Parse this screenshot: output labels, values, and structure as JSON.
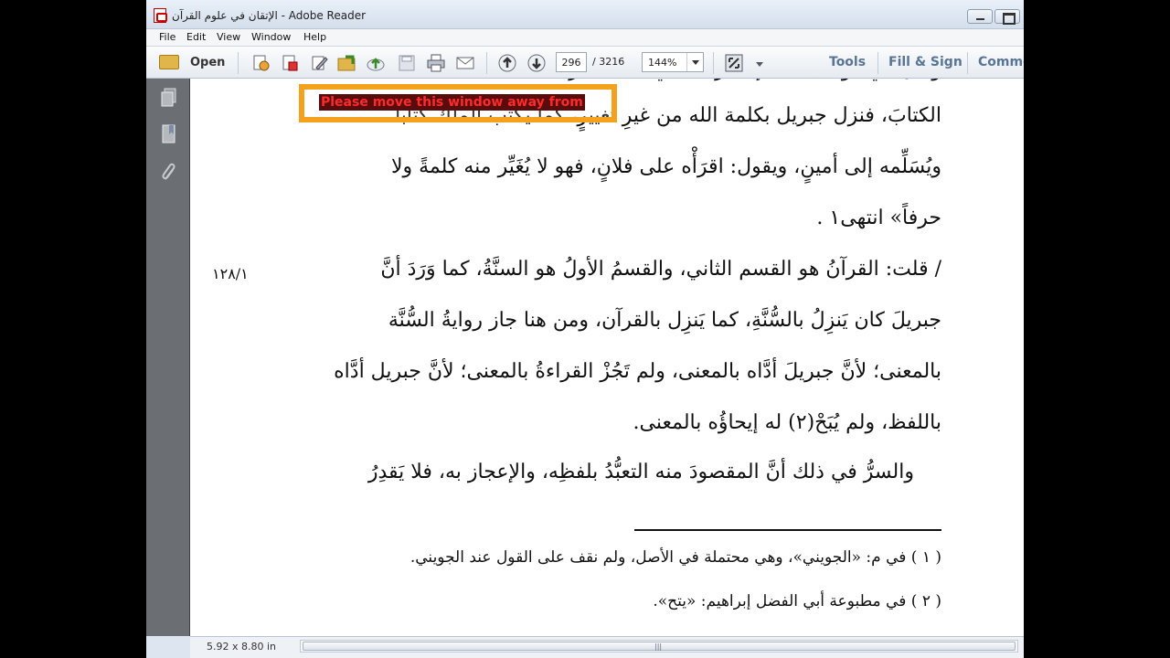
{
  "window": {
    "title": "الإتقان في علوم القرآن - Adobe Reader"
  },
  "menu": [
    "File",
    "Edit",
    "View",
    "Window",
    "Help"
  ],
  "toolbar": {
    "open_label": "Open",
    "page_current": "296",
    "page_total": "/ 3216",
    "zoom": "144%",
    "tabs": [
      "Tools",
      "Fill & Sign",
      "Comme"
    ]
  },
  "overlay": {
    "warning_text": "Please move this window away from"
  },
  "document": {
    "lines": [
      "الكتابَ، فنزل جبريل بكلمة الله من غيرِ تغييرٍ، كما يكتب الملك كتاباً",
      "ويُسَلِّمه إلى أمينٍ، ويقول: اقرَأْه على فلانٍ، فهو لا يُغَيِّر منه كلمةً ولا",
      "حرفاً» انتهى١ .",
      "/ قلت: القرآنُ هو القسم الثاني، والقسمُ الأولُ هو السنَّةُ، كما وَرَدَ أنَّ",
      "جبريلَ كان يَنزِلُ بالسُّنَّةِ، كما يَنزِل بالقرآن، ومن هنا جاز روايةُ السُّنَّة",
      "بالمعنى؛ لأنَّ جبريلَ أدَّاه بالمعنى، ولم تَجُزْ القراءةُ بالمعنى؛ لأنَّ جبريل أدَّاه",
      "باللفظ، ولم يُبَحْ(٢) له إيحاؤُه بالمعنى.",
      "والسرُّ في ذلك أنَّ المقصودَ منه التعبُّدُ بلفظِه، والإعجاز به، فلا يَقدِرُ"
    ],
    "margin_note": "١٢٨/١",
    "footnotes": [
      "( ١ ) في م: «الجويني»، وهي محتملة في الأصل، ولم نقف على القول عند الجويني.",
      "( ٢ ) في مطبوعة أبي الفضل إبراهيم: «يتح»."
    ]
  },
  "status": {
    "page_size": "5.92 x 8.80 in"
  },
  "colors": {
    "warning_border": "#f4a21d",
    "warning_text": "#ff2b2b",
    "warning_bg": "#5a0b0b",
    "tab_text": "#5a7594"
  }
}
